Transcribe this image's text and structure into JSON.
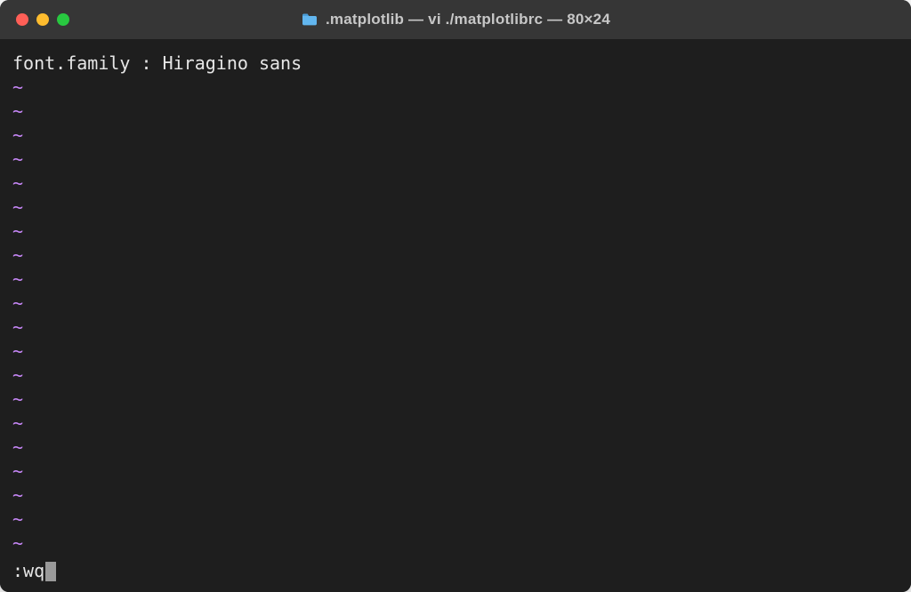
{
  "window": {
    "title": ".matplotlib — vi ./matplotlibrc — 80×24"
  },
  "traffic_lights": {
    "close": "#ff5f57",
    "minimize": "#febc2e",
    "maximize": "#28c840"
  },
  "editor": {
    "content_line": "font.family : Hiragino sans",
    "tilde": "~",
    "tilde_count": 20,
    "command": ":wq"
  },
  "colors": {
    "bg": "#1e1e1e",
    "titlebar": "#363636",
    "text": "#e6e6e6",
    "tilde": "#c586f5",
    "cursor": "#9a9a9a"
  }
}
